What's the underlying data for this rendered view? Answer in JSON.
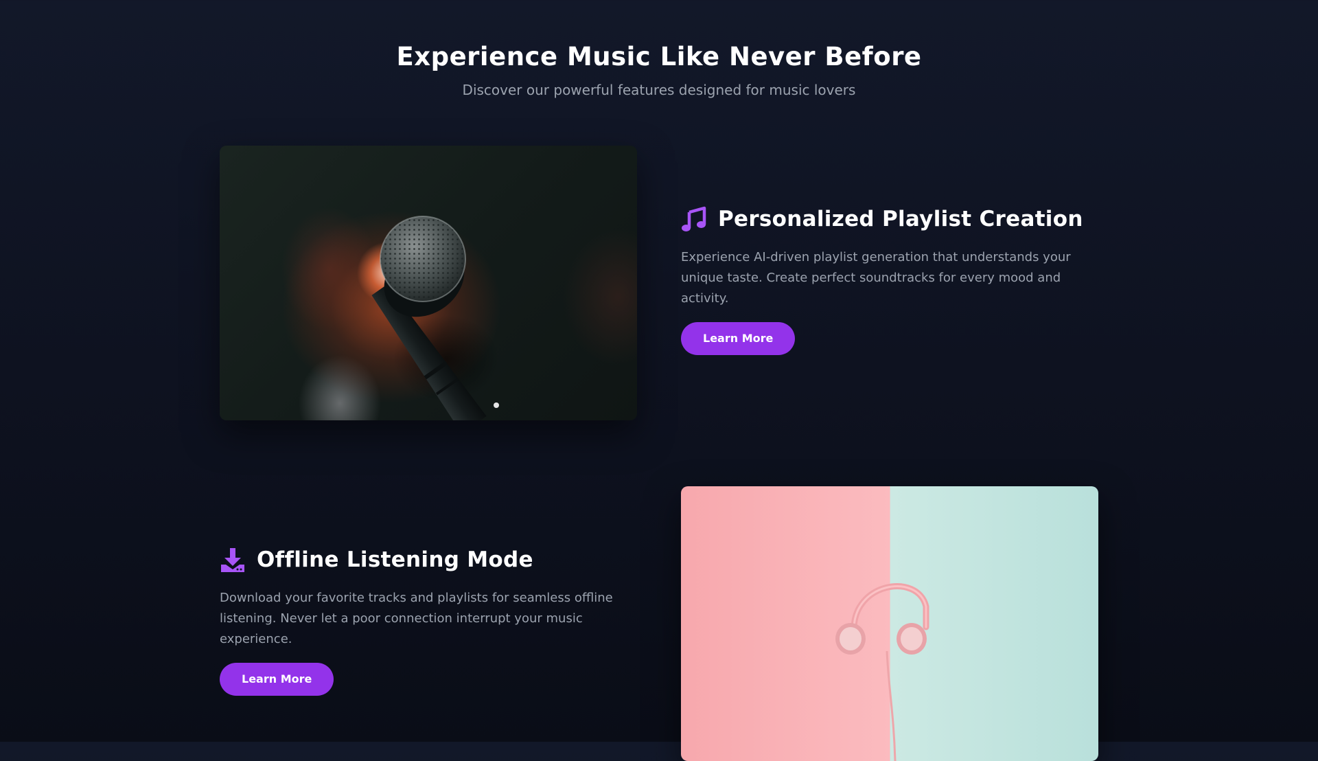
{
  "header": {
    "title": "Experience Music Like Never Before",
    "subtitle": "Discover our powerful features designed for music lovers"
  },
  "features": [
    {
      "icon": "music-note-icon",
      "image": "microphone-photo",
      "title": "Personalized Playlist Creation",
      "description": "Experience AI-driven playlist generation that understands your unique taste. Create perfect soundtracks for every mood and activity.",
      "button_label": "Learn More"
    },
    {
      "icon": "download-icon",
      "image": "headphones-photo",
      "title": "Offline Listening Mode",
      "description": "Download your favorite tracks and playlists for seamless offline listening. Never let a poor connection interrupt your music experience.",
      "button_label": "Learn More"
    }
  ],
  "colors": {
    "accent": "#9333ea",
    "icon": "#a855f7",
    "background": "#0e1220",
    "muted_text": "#9ca3af"
  }
}
